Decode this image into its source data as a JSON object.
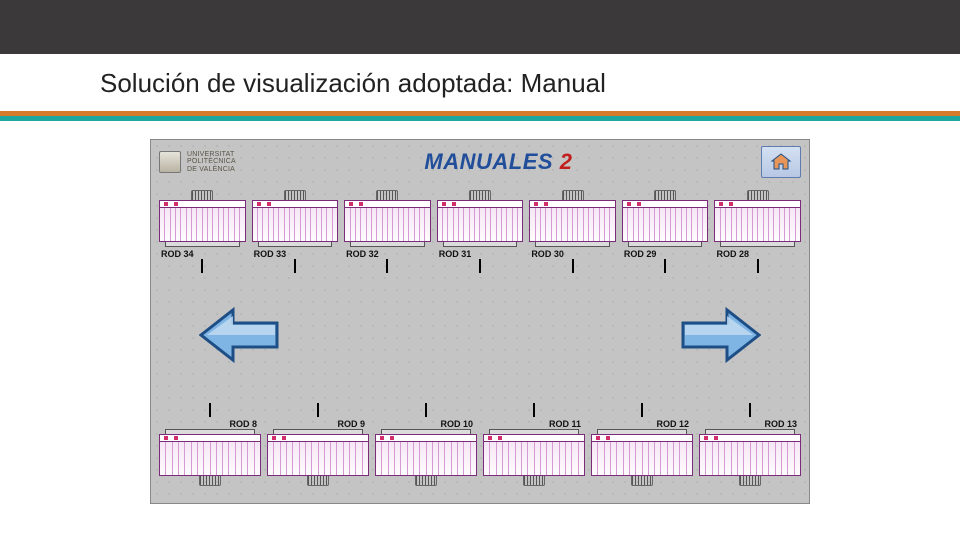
{
  "slide": {
    "title": "Solución de visualización adoptada: Manual"
  },
  "hmi": {
    "logo": {
      "line1": "UNIVERSITAT",
      "line2": "POLITÈCNICA",
      "line3": "DE VALÈNCIA"
    },
    "title": "MANUALES",
    "title_num": "2",
    "home": "home",
    "colors": {
      "accent_blue": "#214e9a",
      "accent_red": "#c21e1e",
      "rack_border": "#7a2c78",
      "arrow_fill": "#5e9dd8",
      "arrow_stroke": "#1e4e86"
    },
    "top_racks": [
      {
        "label": "ROD 34"
      },
      {
        "label": "ROD 33"
      },
      {
        "label": "ROD 32"
      },
      {
        "label": "ROD 31"
      },
      {
        "label": "ROD 30"
      },
      {
        "label": "ROD 29"
      },
      {
        "label": "ROD 28"
      }
    ],
    "bottom_racks": [
      {
        "label": "ROD 8"
      },
      {
        "label": "ROD 9"
      },
      {
        "label": "ROD 10"
      },
      {
        "label": "ROD 11"
      },
      {
        "label": "ROD 12"
      },
      {
        "label": "ROD 13"
      }
    ]
  }
}
